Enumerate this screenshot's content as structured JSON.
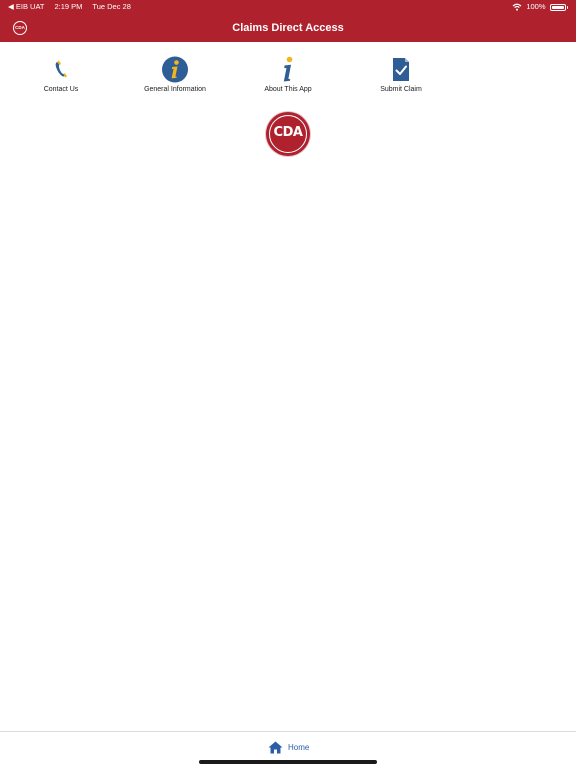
{
  "status_bar": {
    "back_app": "◀ EIB UAT",
    "time": "2:19 PM",
    "date": "Tue Dec 28",
    "battery": "100%"
  },
  "navbar": {
    "logo_text": "CDA",
    "title": "Claims Direct Access"
  },
  "menu": [
    {
      "label": "Contact Us",
      "icon": "phone-icon"
    },
    {
      "label": "General Information",
      "icon": "info-circle-icon"
    },
    {
      "label": "About This App",
      "icon": "info-icon"
    },
    {
      "label": "Submit Claim",
      "icon": "document-check-icon"
    }
  ],
  "center_logo": {
    "text": "CDA"
  },
  "tabbar": {
    "home_label": "Home",
    "home_icon": "home-icon"
  },
  "colors": {
    "brand_red": "#b0212e",
    "icon_blue": "#2f5d95",
    "accent_yellow": "#f2b51d",
    "tab_blue": "#2b5ea7"
  }
}
